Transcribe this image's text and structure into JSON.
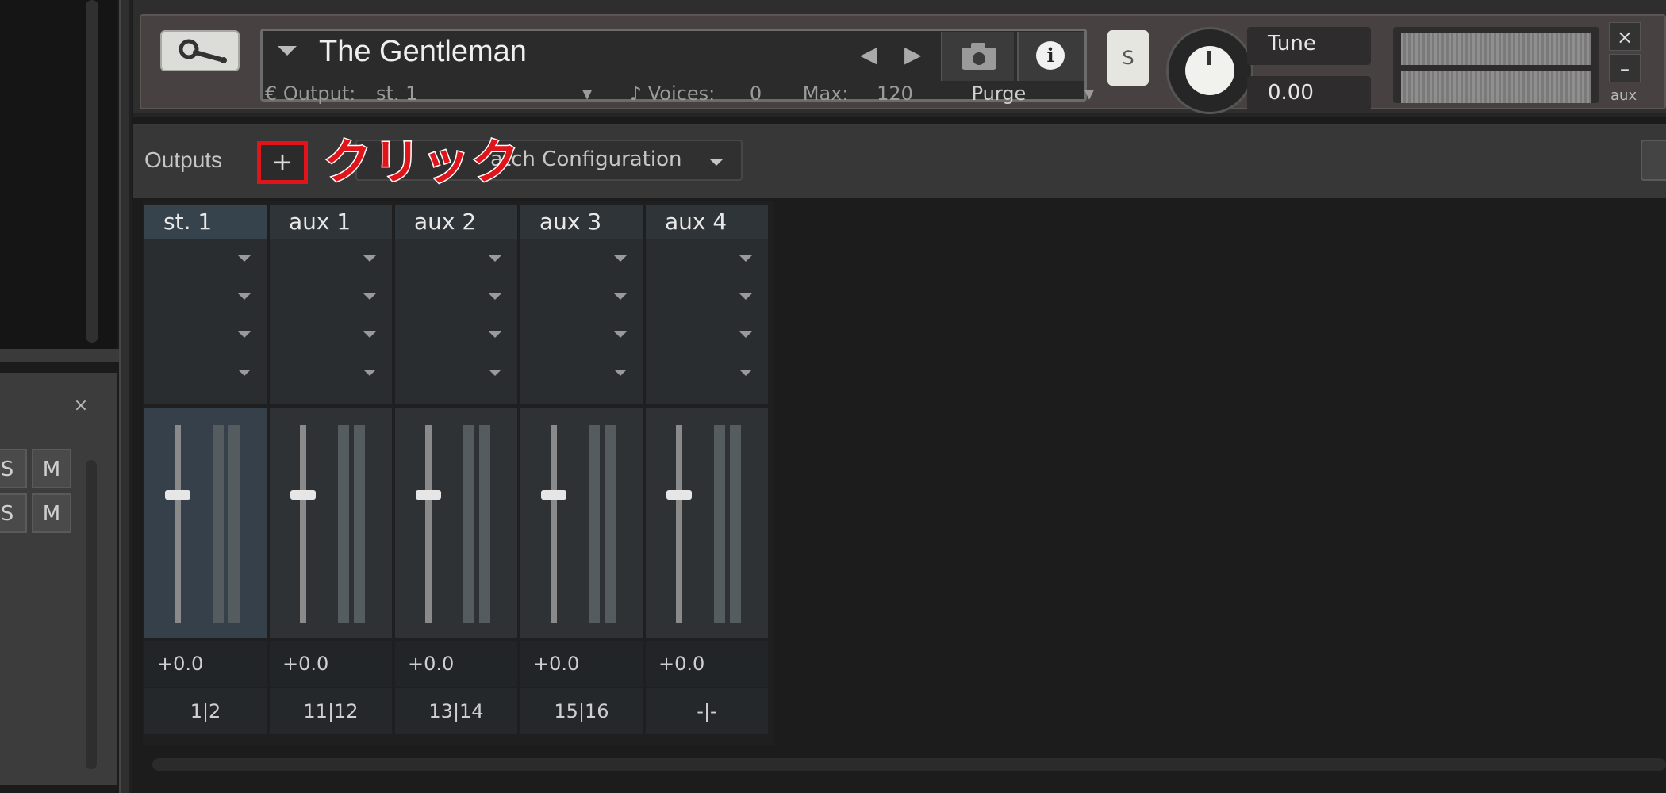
{
  "left_panel": {
    "close_glyph": "×",
    "rows": [
      {
        "solo": "S",
        "mute": "M"
      },
      {
        "solo": "S",
        "mute": "M"
      }
    ]
  },
  "instrument": {
    "name": "The Gentleman",
    "output_label": "Output:",
    "output_value": "st. 1",
    "voices_label": "Voices:",
    "voices_value": "0",
    "max_label": "Max:",
    "max_value": "120",
    "purge_label": "Purge",
    "solo_label": "S",
    "tune_label": "Tune",
    "tune_value": "0.00",
    "aux_label": "aux",
    "close_glyph": "×",
    "minimize_glyph": "–",
    "prev_glyph": "◀",
    "next_glyph": "▶",
    "info_glyph": "i",
    "icons": [
      "wrench-icon",
      "camera-icon",
      "info-icon",
      "knob-icon"
    ]
  },
  "outputs": {
    "title": "Outputs",
    "add_glyph": "+",
    "batch_label": "atch Configuration",
    "annotation": "クリック",
    "channels": [
      {
        "name": "st. 1",
        "level": "+0.0",
        "output": "1|2",
        "selected": true
      },
      {
        "name": "aux 1",
        "level": "+0.0",
        "output": "11|12",
        "selected": false
      },
      {
        "name": "aux 2",
        "level": "+0.0",
        "output": "13|14",
        "selected": false
      },
      {
        "name": "aux 3",
        "level": "+0.0",
        "output": "15|16",
        "selected": false
      },
      {
        "name": "aux 4",
        "level": "+0.0",
        "output": "-|-",
        "selected": false
      }
    ]
  }
}
